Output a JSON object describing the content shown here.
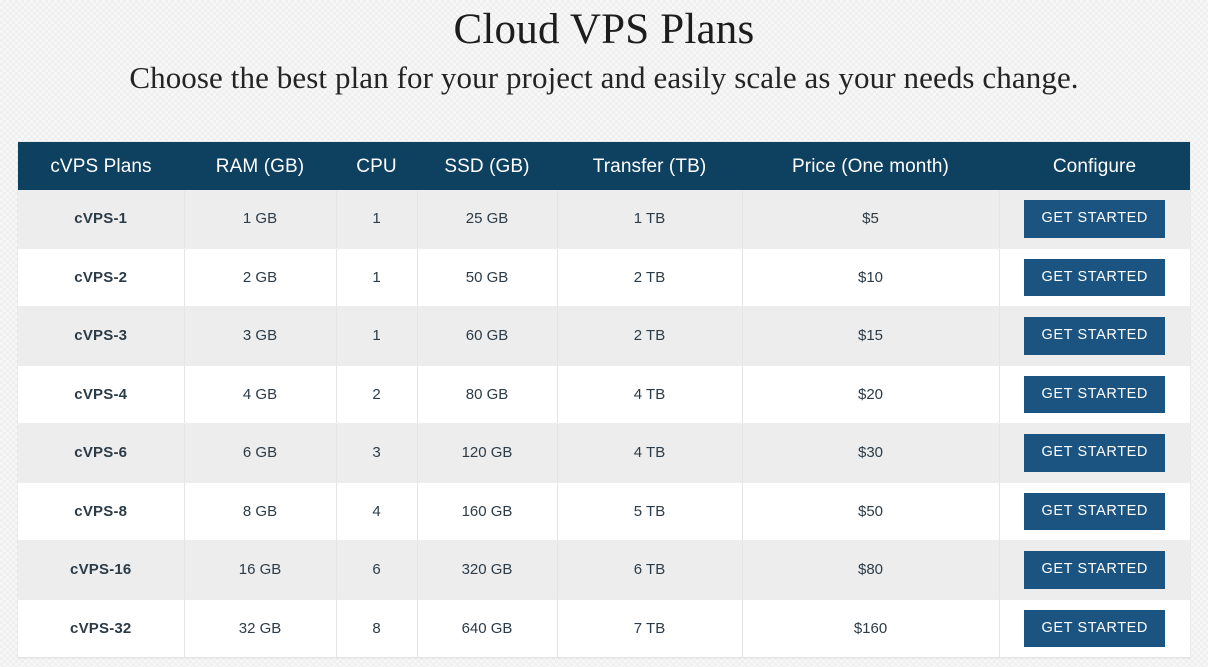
{
  "header": {
    "title": "Cloud VPS Plans",
    "subtitle": "Choose the best plan for your project and easily scale as your needs change."
  },
  "theme": {
    "header_row_bg": "#0e4060",
    "button_bg": "#1b5480",
    "button_text": "#ffffff",
    "plan_name_color": "#12354f",
    "cell_text_color": "#2b3b47",
    "row_alt_bg": "#ededed",
    "row_bg": "#ffffff",
    "page_bg": "#f7f7f7"
  },
  "table": {
    "columns": [
      {
        "key": "plan",
        "label": "cVPS Plans"
      },
      {
        "key": "ram",
        "label": "RAM (GB)"
      },
      {
        "key": "cpu",
        "label": "CPU"
      },
      {
        "key": "ssd",
        "label": "SSD (GB)"
      },
      {
        "key": "transfer",
        "label": "Transfer (TB)"
      },
      {
        "key": "price",
        "label": "Price (One month)"
      },
      {
        "key": "configure",
        "label": "Configure"
      }
    ],
    "cta_label": "GET STARTED",
    "rows": [
      {
        "plan": "cVPS-1",
        "ram": "1 GB",
        "cpu": "1",
        "ssd": "25 GB",
        "transfer": "1 TB",
        "price": "$5",
        "cta": "GET STARTED"
      },
      {
        "plan": "cVPS-2",
        "ram": "2 GB",
        "cpu": "1",
        "ssd": "50 GB",
        "transfer": "2 TB",
        "price": "$10",
        "cta": "GET STARTED"
      },
      {
        "plan": "cVPS-3",
        "ram": "3 GB",
        "cpu": "1",
        "ssd": "60 GB",
        "transfer": "2 TB",
        "price": "$15",
        "cta": "GET STARTED"
      },
      {
        "plan": "cVPS-4",
        "ram": "4 GB",
        "cpu": "2",
        "ssd": "80 GB",
        "transfer": "4 TB",
        "price": "$20",
        "cta": "GET STARTED"
      },
      {
        "plan": "cVPS-6",
        "ram": "6 GB",
        "cpu": "3",
        "ssd": "120 GB",
        "transfer": "4 TB",
        "price": "$30",
        "cta": "GET STARTED"
      },
      {
        "plan": "cVPS-8",
        "ram": "8 GB",
        "cpu": "4",
        "ssd": "160 GB",
        "transfer": "5 TB",
        "price": "$50",
        "cta": "GET STARTED"
      },
      {
        "plan": "cVPS-16",
        "ram": "16 GB",
        "cpu": "6",
        "ssd": "320 GB",
        "transfer": "6 TB",
        "price": "$80",
        "cta": "GET STARTED"
      },
      {
        "plan": "cVPS-32",
        "ram": "32 GB",
        "cpu": "8",
        "ssd": "640 GB",
        "transfer": "7 TB",
        "price": "$160",
        "cta": "GET STARTED"
      }
    ]
  }
}
